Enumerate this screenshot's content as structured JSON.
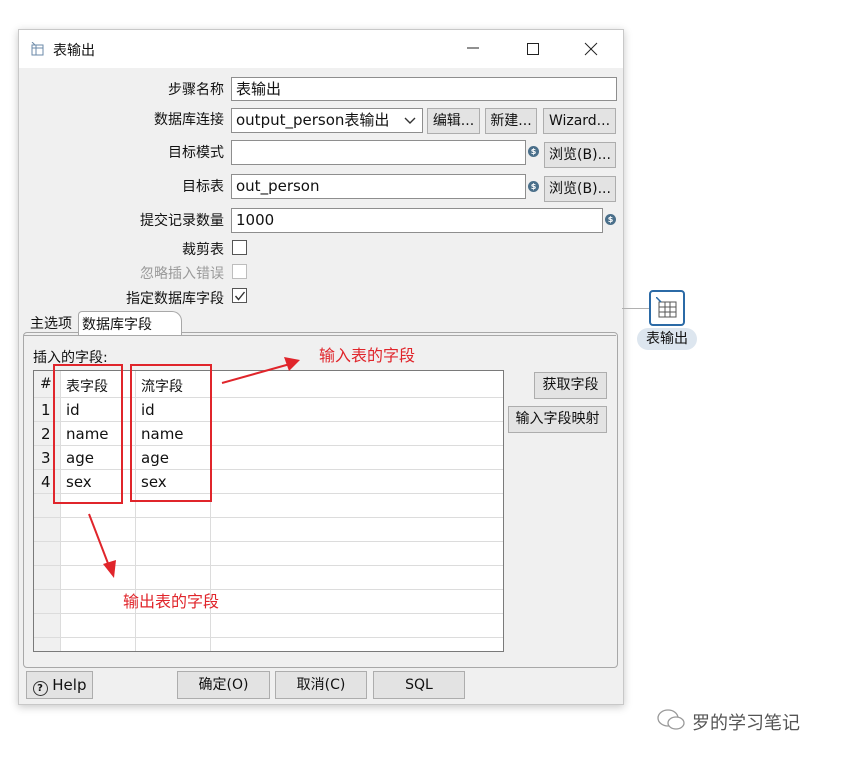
{
  "window": {
    "title": "表输出"
  },
  "form": {
    "step_name_label": "步骤名称",
    "step_name_value": "表输出",
    "db_conn_label": "数据库连接",
    "db_conn_value": "output_person表输出",
    "edit_btn": "编辑...",
    "new_btn": "新建...",
    "wizard_btn": "Wizard...",
    "target_schema_label": "目标模式",
    "target_schema_value": "",
    "browse_btn": "浏览(B)...",
    "target_table_label": "目标表",
    "target_table_value": "out_person",
    "commit_size_label": "提交记录数量",
    "commit_size_value": "1000",
    "truncate_label": "裁剪表",
    "truncate_checked": false,
    "ignore_errors_label": "忽略插入错误",
    "ignore_errors_checked": false,
    "specify_fields_label": "指定数据库字段",
    "specify_fields_checked": true
  },
  "tabs": [
    "主选项",
    "数据库字段"
  ],
  "fields_section": {
    "label": "插入的字段:",
    "columns": [
      "#",
      "表字段",
      "流字段"
    ],
    "rows": [
      [
        "1",
        "id",
        "id"
      ],
      [
        "2",
        "name",
        "name"
      ],
      [
        "3",
        "age",
        "age"
      ],
      [
        "4",
        "sex",
        "sex"
      ]
    ],
    "get_fields_btn": "获取字段",
    "map_fields_btn": "输入字段映射"
  },
  "footer": {
    "help": "Help",
    "ok": "确定(O)",
    "cancel": "取消(C)",
    "sql": "SQL"
  },
  "annotations": {
    "input_fields": "输入表的字段",
    "output_fields": "输出表的字段"
  },
  "canvas_step": {
    "label": "表输出"
  },
  "watermark": "罗的学习笔记",
  "colors": {
    "annotation": "#e0252b",
    "step_icon": "#2b6aa6"
  }
}
